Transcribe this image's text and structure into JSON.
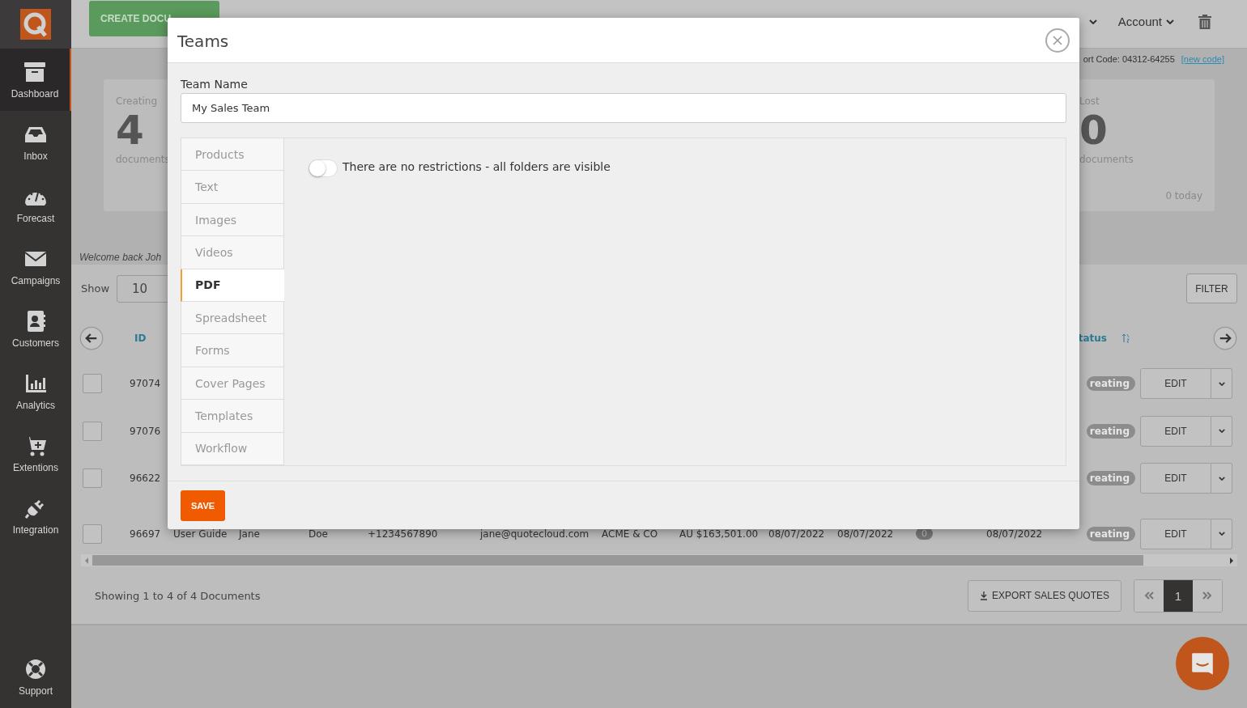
{
  "sidebar": {
    "items": [
      {
        "label": "Dashboard",
        "kind": "archive",
        "selected": true
      },
      {
        "label": "Inbox",
        "kind": "inbox",
        "selected": false
      },
      {
        "label": "Forecast",
        "kind": "gauge",
        "selected": false
      },
      {
        "label": "Campaigns",
        "kind": "envelope",
        "selected": false
      },
      {
        "label": "Customers",
        "kind": "contact",
        "selected": false
      },
      {
        "label": "Analytics",
        "kind": "chart",
        "selected": false
      },
      {
        "label": "Extentions",
        "kind": "cart",
        "selected": false
      },
      {
        "label": "Integration",
        "kind": "plug",
        "selected": false
      }
    ],
    "support": "Support"
  },
  "topbar": {
    "create_button": "CREATE DOCU",
    "account": "Account"
  },
  "support_code": {
    "text": "ort Code: 04312-64255",
    "link": "[new code]"
  },
  "cards": [
    {
      "label": "Creating",
      "count": "4",
      "caption": "documents"
    },
    {
      "label": "Lost",
      "count": "0",
      "caption": "documents",
      "today": "0 today"
    }
  ],
  "welcome": "Welcome back Joh",
  "table": {
    "show_label": "Show",
    "page_size": "10",
    "filter": "FILTER",
    "columns": [
      {
        "label": "ID"
      },
      {
        "label": "tatus"
      }
    ],
    "rows": [
      {
        "id": "97074",
        "checked": false,
        "status": "reating",
        "action": "EDIT"
      },
      {
        "id": "97076",
        "checked": false,
        "status": "reating",
        "action": "EDIT"
      },
      {
        "id": "96622",
        "checked": false,
        "status": "reating",
        "action": "EDIT"
      },
      {
        "id": "96697",
        "checked": false,
        "status": "reating",
        "action": "EDIT",
        "cells": [
          "User Guide",
          "Jane",
          "Doe",
          "+1234567890",
          "jane@quotecloud.com",
          "ACME & CO",
          "AU $163,501.00",
          "08/07/2022",
          "08/07/2022",
          "0",
          "08/07/2022"
        ]
      }
    ]
  },
  "footer": {
    "summary": "Showing 1 to 4 of 4 Documents",
    "export": "EXPORT SALES QUOTES",
    "pages": [
      {
        "label": "1",
        "selected": true
      }
    ]
  },
  "modal": {
    "title": "Teams",
    "field": {
      "label": "Team Name",
      "value": "My Sales Team"
    },
    "tabs": [
      {
        "label": "Products",
        "selected": false
      },
      {
        "label": "Text",
        "selected": false
      },
      {
        "label": "Images",
        "selected": false
      },
      {
        "label": "Videos",
        "selected": false
      },
      {
        "label": "PDF",
        "selected": true
      },
      {
        "label": "Spreadsheet",
        "selected": false
      },
      {
        "label": "Forms",
        "selected": false
      },
      {
        "label": "Cover Pages",
        "selected": false
      },
      {
        "label": "Templates",
        "selected": false
      },
      {
        "label": "Workflow",
        "selected": false
      }
    ],
    "toggle": {
      "on": false,
      "label": "There are no restrictions - all folders are visible"
    },
    "save": "SAVE"
  }
}
